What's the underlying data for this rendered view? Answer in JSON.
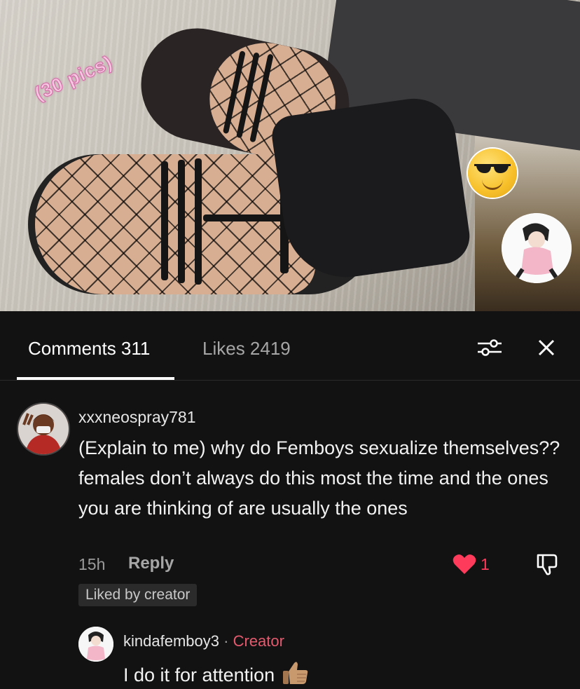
{
  "photo": {
    "caption": "(30 pics)",
    "sticker": "smiling-face-with-sunglasses-icon"
  },
  "tabs": {
    "comments_label": "Comments 311",
    "likes_label": "Likes 2419"
  },
  "icons": {
    "filter": "filter-sliders-icon",
    "close": "close-icon"
  },
  "comment": {
    "username": "xxxneospray781",
    "text": "(Explain to me) why do Femboys sexualize themselves?? females don’t always do this most the time and the ones you are thinking of are usually the ones",
    "time": "15h",
    "reply_label": "Reply",
    "like_count": "1",
    "liked_badge": "Liked by creator"
  },
  "reply": {
    "username": "kindafemboy3",
    "separator": "·",
    "creator_label": "Creator",
    "text": "I do it for attention"
  },
  "colors": {
    "background": "#121212",
    "heart": "#ff3b5c",
    "creator": "#e45a6e"
  }
}
